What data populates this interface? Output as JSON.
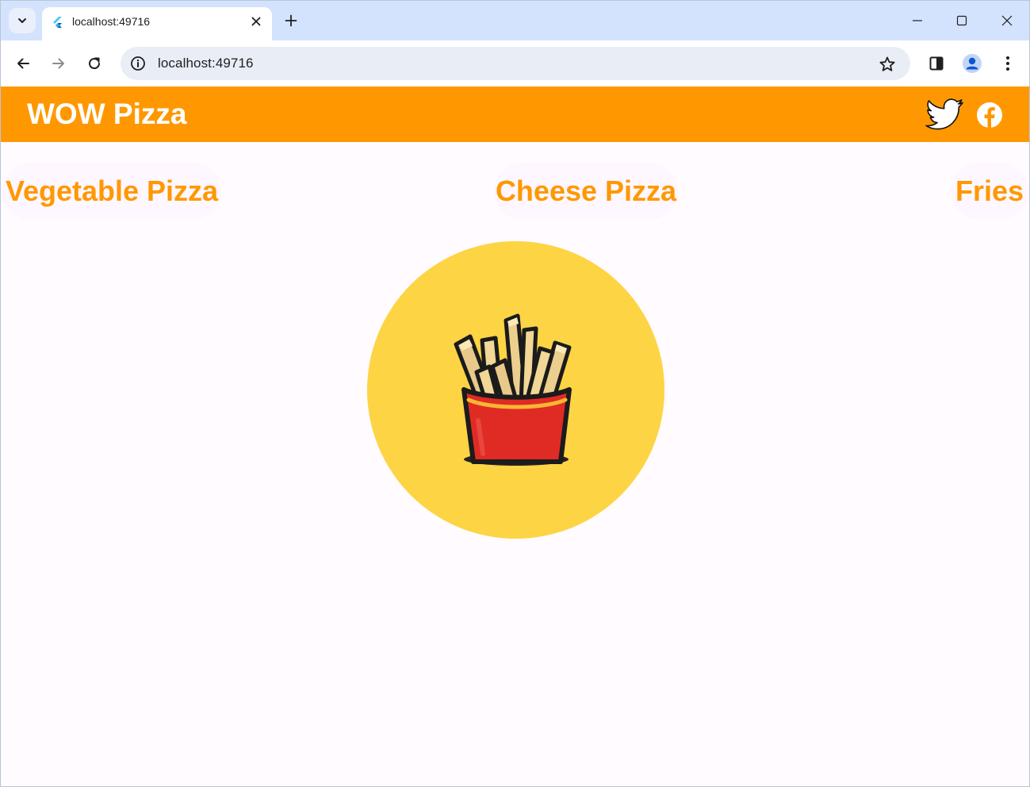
{
  "browser": {
    "tab": {
      "title": "localhost:49716"
    },
    "address_bar": {
      "url": "localhost:49716"
    }
  },
  "app": {
    "title": "WOW Pizza",
    "social": [
      "twitter-icon",
      "facebook-icon"
    ]
  },
  "menu": {
    "items": [
      {
        "label": "Vegetable Pizza"
      },
      {
        "label": "Cheese Pizza"
      },
      {
        "label": "Fries"
      }
    ],
    "selected": "Fries"
  },
  "hero": {
    "icon": "fries-icon"
  },
  "colors": {
    "accent": "#ff9800",
    "background": "#fffbfe",
    "circle": "#fdd444",
    "fries_box": "#e53935"
  }
}
